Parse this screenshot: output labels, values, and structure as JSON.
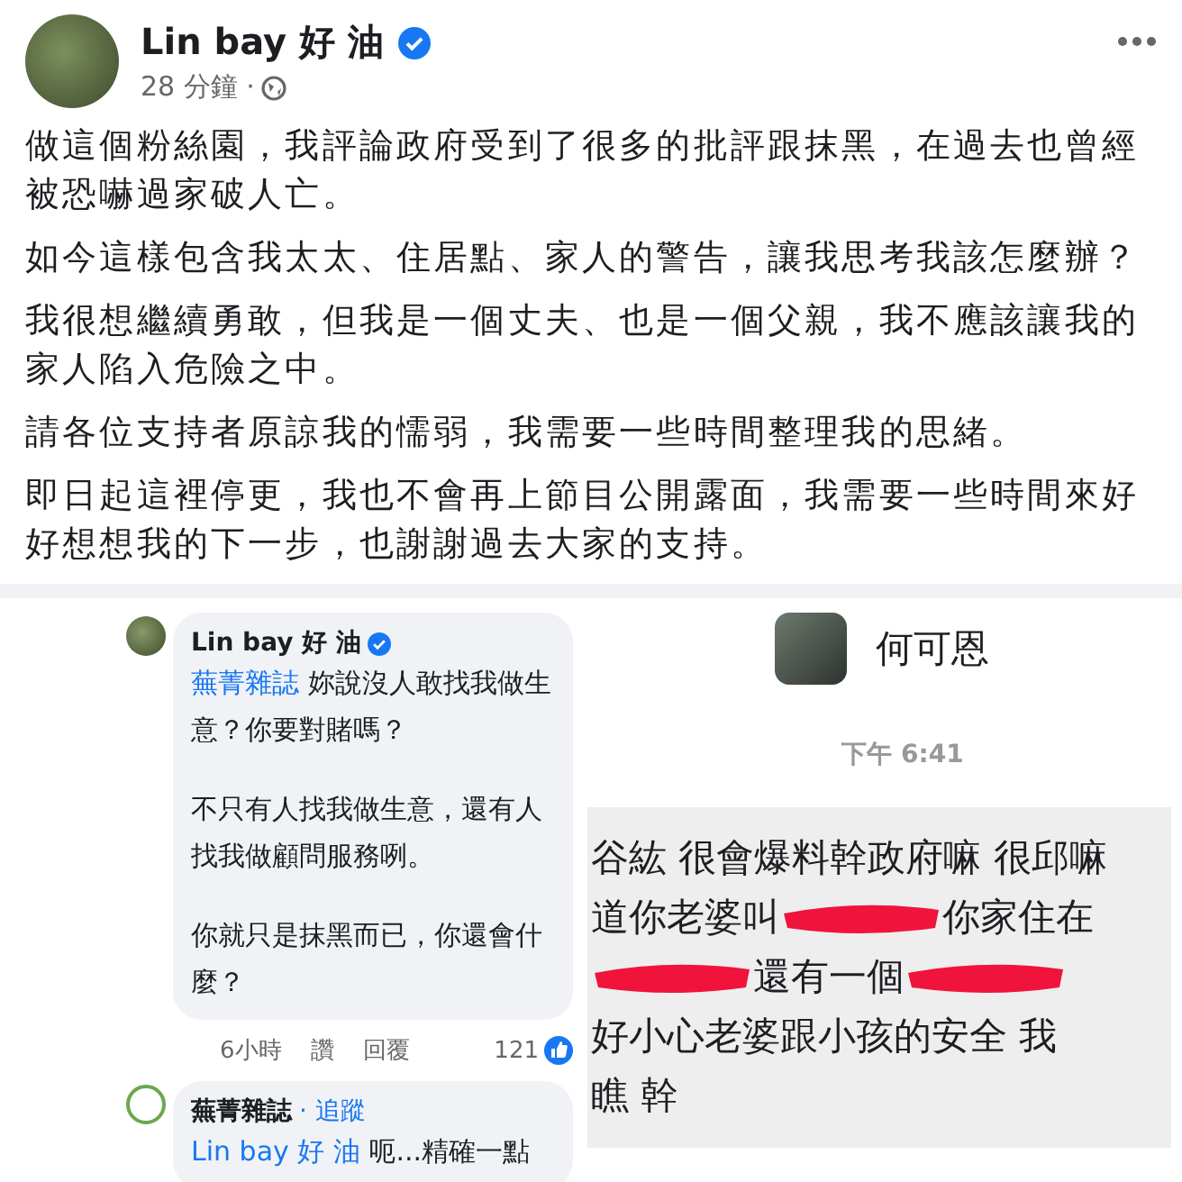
{
  "post": {
    "author": "Lin bay 好 油",
    "verified": true,
    "time": "28 分鐘 ·",
    "paragraphs": [
      "做這個粉絲園，我評論政府受到了很多的批評跟抹黑，在過去也曾經被恐嚇過家破人亡。",
      "如今這樣包含我太太、住居點、家人的警告，讓我思考我該怎麼辦？",
      "我很想繼續勇敢，但我是一個丈夫、也是一個父親，我不應該讓我的家人陷入危險之中。",
      "請各位支持者原諒我的懦弱，我需要一些時間整理我的思緒。",
      "即日起這裡停更，我也不會再上節目公開露面，我需要一些時間來好好想想我的下一步，也謝謝過去大家的支持。"
    ]
  },
  "comments": [
    {
      "author": "Lin bay 好 油",
      "verified": true,
      "mention": "蕪菁雜誌",
      "texts": [
        "妳說沒人敢找我做生意？你要對賭嗎？",
        "不只有人找我做生意，還有人找我做顧問服務咧。",
        "你就只是抹黑而已，你還會什麼？"
      ],
      "time": "6小時",
      "actions": [
        "讚",
        "回覆"
      ],
      "reactions": "121"
    },
    {
      "author": "蕪菁雜誌",
      "follow": "· 追蹤",
      "mention": "Lin bay 好 油",
      "texts": [
        "呃...精確一點"
      ]
    }
  ],
  "chat": {
    "contact": "何可恩",
    "time": "下午 6:41",
    "lines": [
      [
        {
          "kind": "text",
          "text": "谷紘 很會爆料幹政府嘛 很邱嘛"
        }
      ],
      [
        {
          "kind": "text",
          "text": "道你老婆叫"
        },
        {
          "kind": "redaction"
        },
        {
          "kind": "text",
          "text": "你家住在"
        }
      ],
      [
        {
          "kind": "redaction"
        },
        {
          "kind": "text",
          "text": "還有一個"
        },
        {
          "kind": "redaction"
        }
      ],
      [
        {
          "kind": "text",
          "text": "好小心老婆跟小孩的安全 我"
        }
      ],
      [
        {
          "kind": "text",
          "text": "瞧 幹"
        }
      ]
    ]
  }
}
